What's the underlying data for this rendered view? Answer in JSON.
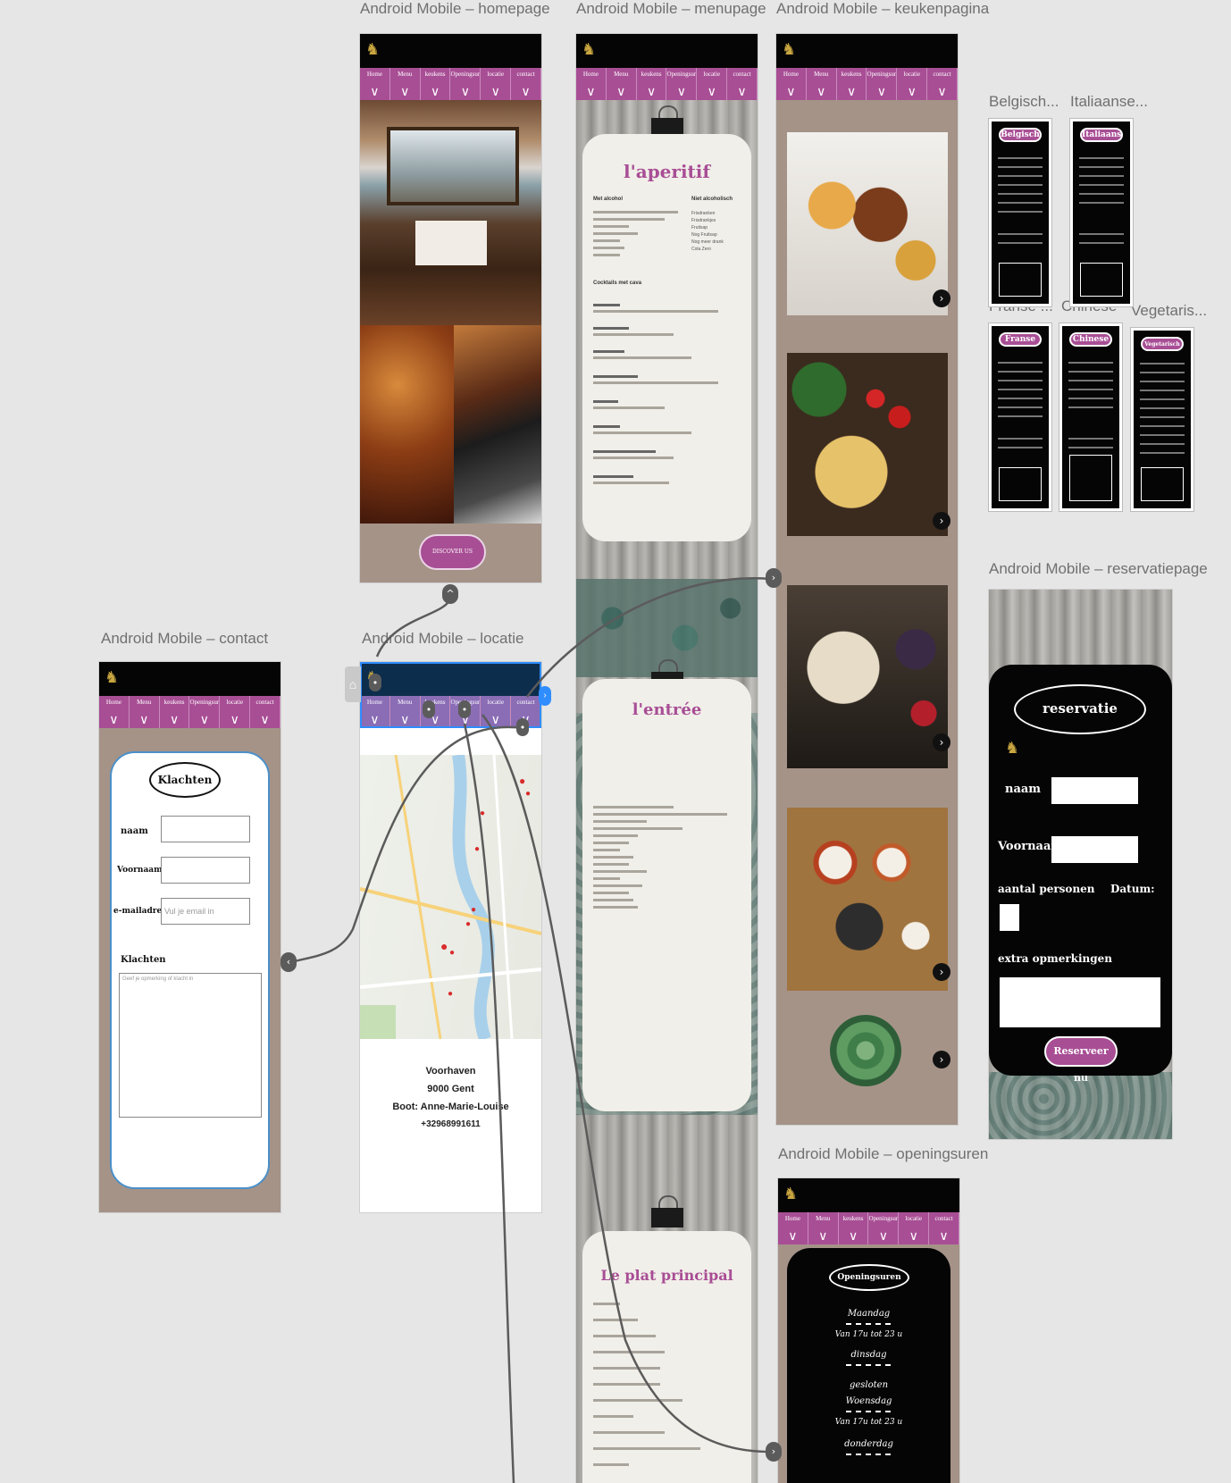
{
  "artboards": {
    "homepage": {
      "title": "Android Mobile – homepage",
      "cta": "DISCOVER US"
    },
    "menupage": {
      "title": "Android Mobile – menupage"
    },
    "keukenpagina": {
      "title": "Android Mobile – keukenpagina"
    },
    "contact": {
      "title": "Android Mobile – contact"
    },
    "locatie": {
      "title": "Android Mobile – locatie"
    },
    "reservatiepage": {
      "title": "Android Mobile – reservatiepage"
    },
    "openingsuren": {
      "title": "Android Mobile – openingsuren"
    }
  },
  "nav": {
    "items": [
      "Home",
      "Menu",
      "keukens",
      "Openingsuren",
      "locatie",
      "contact"
    ]
  },
  "menu": {
    "aperitif": {
      "title": "l'aperitif",
      "col1_header": "Met alcohol",
      "col2_header": "Niet alcoholisch",
      "col2_items": [
        "Frisdranken",
        "Frisdrankjes",
        "Fruitsap",
        "Nog Fruitsap",
        "Nog meer drank",
        "Cola Zero"
      ],
      "section": "Cocktails met cava"
    },
    "entree": {
      "title": "l'entrée"
    },
    "plat": {
      "title": "Le plat principal"
    }
  },
  "cuisines": [
    {
      "label": "Belgisch...",
      "pill": "Belgisch"
    },
    {
      "label": "Italiaanse...",
      "pill": "Italiaanse"
    },
    {
      "label": "Franse ...",
      "pill": "Franse"
    },
    {
      "label": "Chinese",
      "pill": "Chinese"
    },
    {
      "label": "Vegetaris...",
      "pill": "Vegetarisch"
    }
  ],
  "contact": {
    "heading": "Klachten",
    "naam": "naam",
    "voornaam": "Voornaam",
    "email": "e-mailadres",
    "email_placeholder": "Vul je email in",
    "klachten": "Klachten",
    "klachten_placeholder": "Geef je opmerking of klacht in"
  },
  "locatie": {
    "address1": "Voorhaven",
    "address2": "9000 Gent",
    "address3": "Boot: Anne-Marie-Louise",
    "phone": "+32968991611"
  },
  "reservatie": {
    "heading": "reservatie",
    "naam": "naam",
    "voornaam": "Voornaam",
    "personen": "aantal personen",
    "datum": "Datum:",
    "opmerkingen": "extra opmerkingen",
    "button": "Reserveer nu"
  },
  "openingsuren": {
    "heading": "Openingsuren",
    "lines": [
      "Maandag",
      "Van 17u tot 23 u",
      "dinsdag",
      "gesloten",
      "Woensdag",
      "Van 17u tot 23 u",
      "donderdag"
    ]
  },
  "colors": {
    "accent": "#a84e95",
    "canvas": "#e6e6e6",
    "dark": "#050505",
    "frame_brown": "#a59388"
  }
}
